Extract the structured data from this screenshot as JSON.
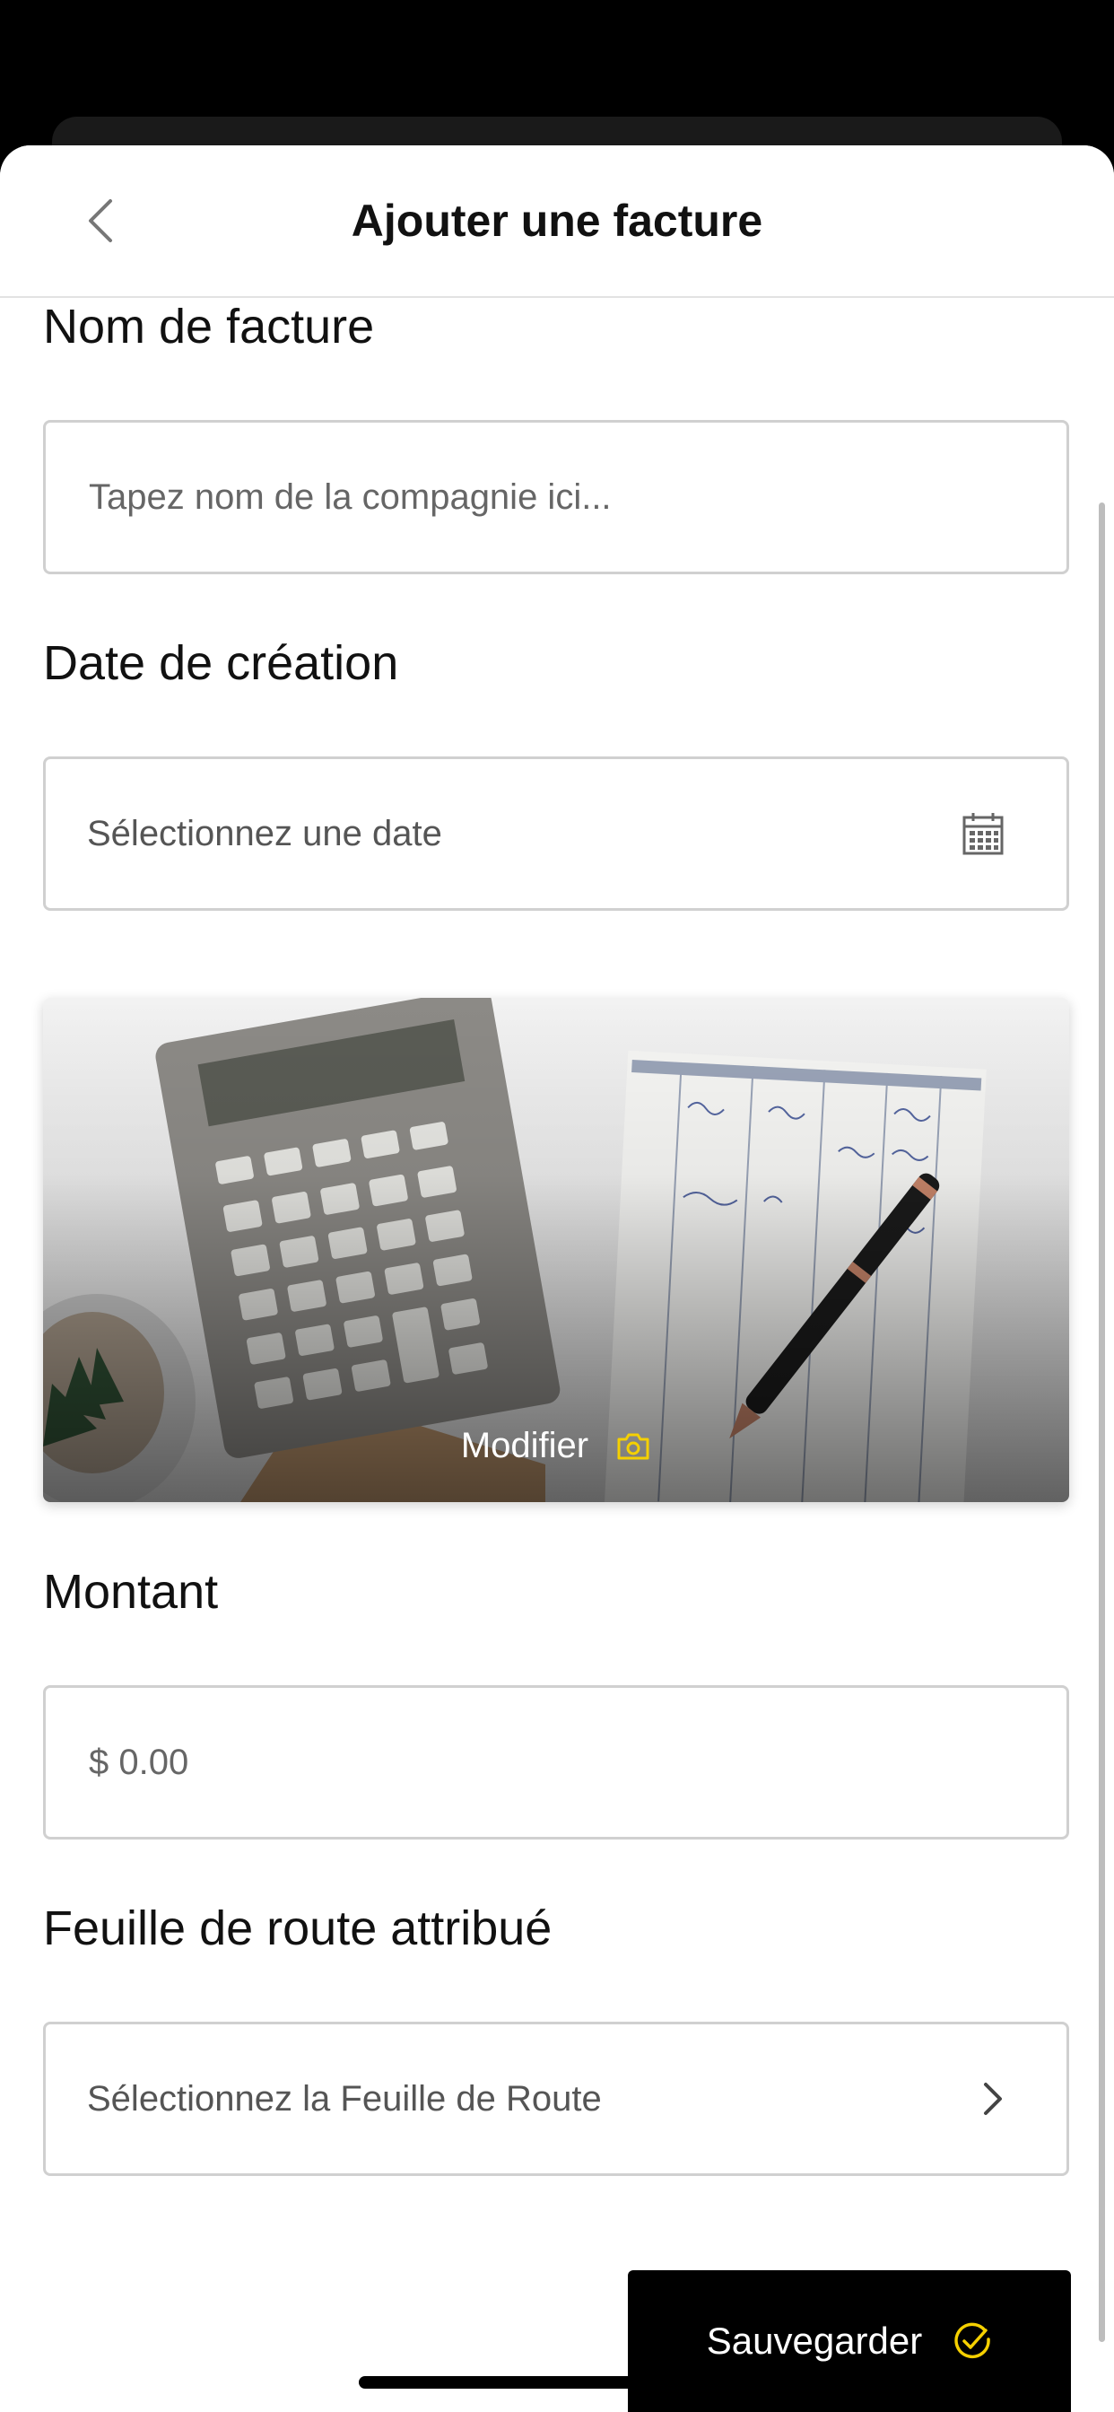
{
  "header": {
    "title": "Ajouter une facture"
  },
  "form": {
    "invoice_name": {
      "label": "Nom de facture",
      "placeholder": "Tapez nom de la compagnie ici..."
    },
    "creation_date": {
      "label": "Date de création",
      "placeholder": "Sélectionnez une date"
    },
    "image": {
      "modify_label": "Modifier"
    },
    "amount": {
      "label": "Montant",
      "placeholder": "$ 0.00"
    },
    "route_sheet": {
      "label": "Feuille de route attribué",
      "placeholder": "Sélectionnez la Feuille de Route"
    }
  },
  "actions": {
    "save_label": "Sauvegarder"
  },
  "icons": {
    "back": "chevron-left-icon",
    "calendar": "calendar-icon",
    "camera": "camera-icon",
    "chevron": "chevron-right-icon",
    "check": "check-circle-icon"
  },
  "colors": {
    "accent": "#f5d000",
    "border": "#d0d0d0",
    "button": "#000000"
  }
}
